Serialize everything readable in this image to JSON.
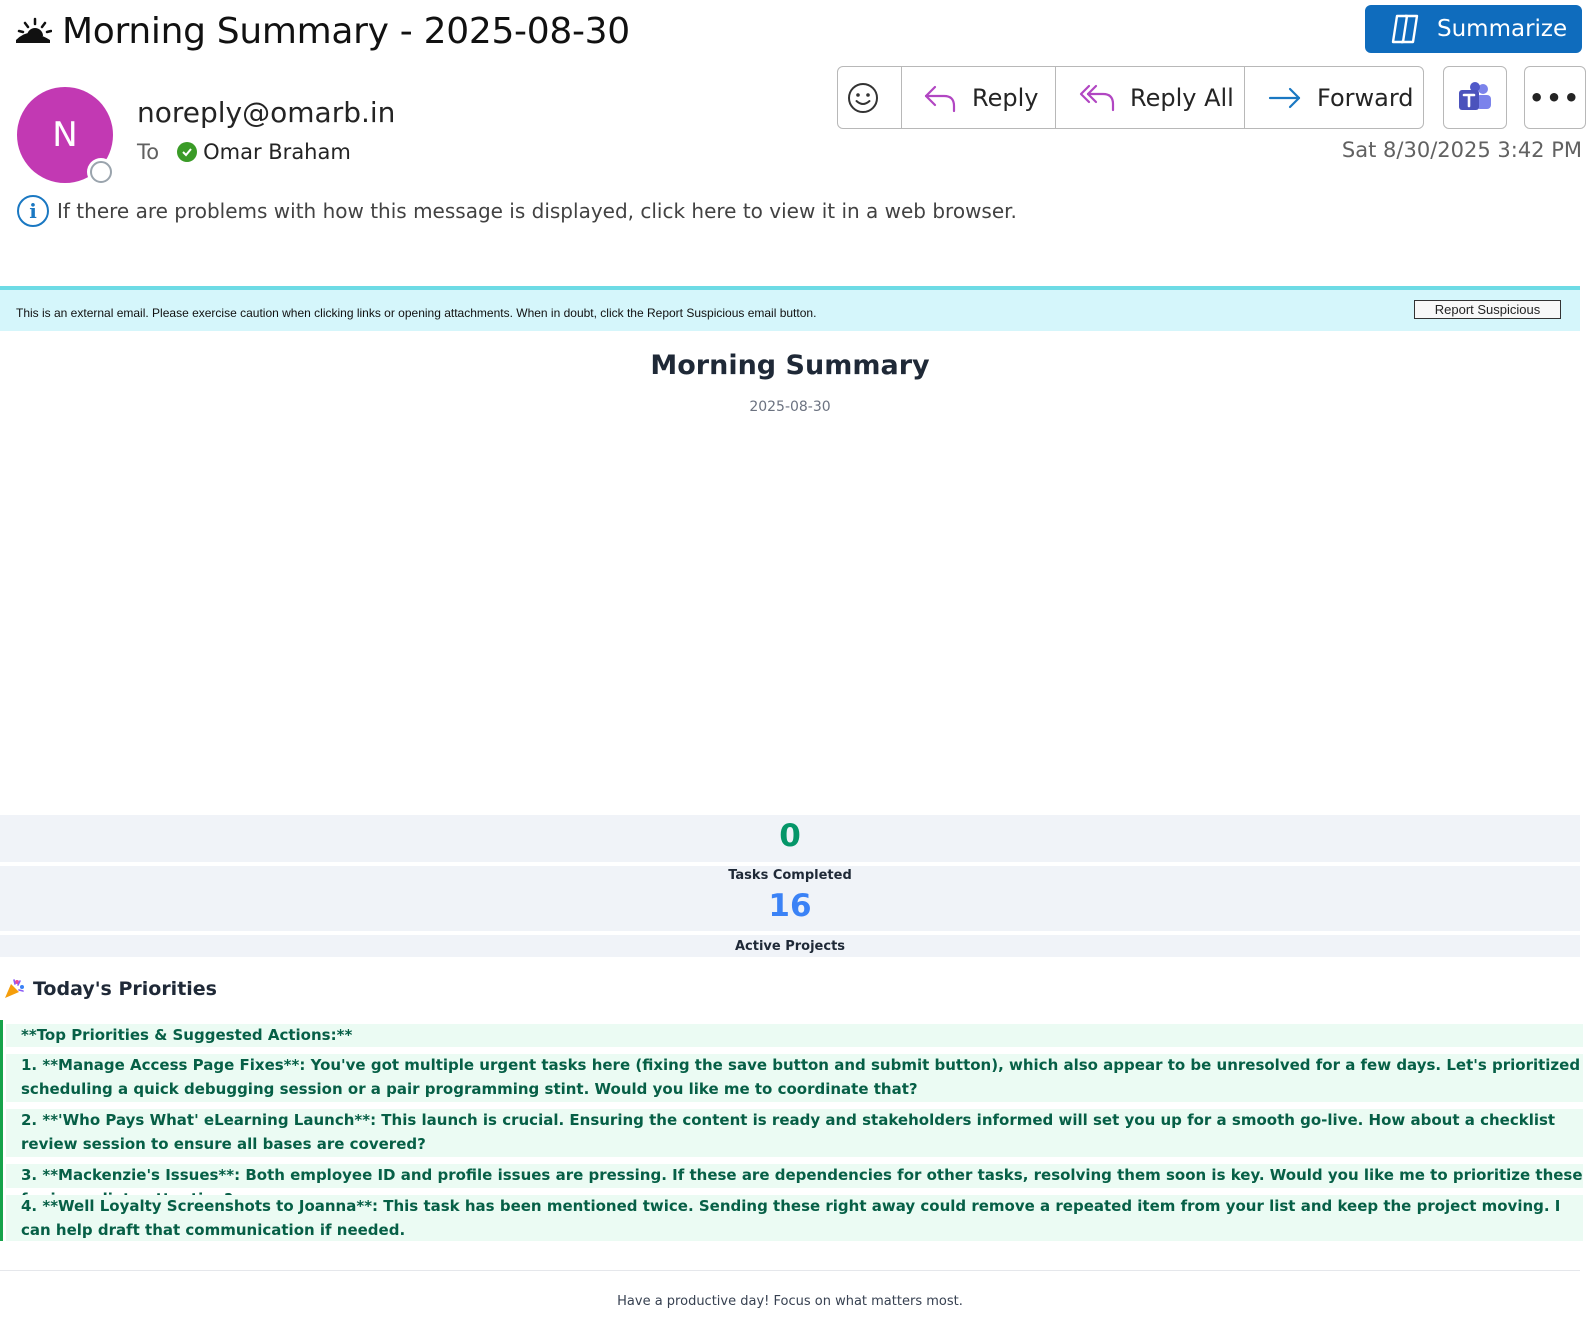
{
  "header": {
    "subject": "Morning Summary - 2025-08-30",
    "summarize_label": "Summarize",
    "sender_initial": "N",
    "sender": "noreply@omarb.in",
    "to_label": "To",
    "recipient": "Omar Braham",
    "date": "Sat 8/30/2025 3:42 PM",
    "actions": {
      "reply": "Reply",
      "reply_all": "Reply All",
      "forward": "Forward",
      "more": "•••"
    },
    "info_text": "If there are problems with how this message is displayed, click here to view it in a web browser."
  },
  "banner": {
    "text": "This is an external email. Please exercise caution when clicking links or opening attachments. When in doubt, click the Report Suspicious email button.",
    "report_label": "Report Suspicious"
  },
  "body": {
    "title": "Morning Summary",
    "date": "2025-08-30",
    "stats": [
      {
        "value": "0",
        "label": "Tasks Completed",
        "color": "#059669"
      },
      {
        "value": "16",
        "label": "Active Projects",
        "color": "#3b82f6"
      }
    ],
    "priorities_title": "Today's Priorities",
    "priorities": [
      "**Top Priorities & Suggested Actions:**",
      "1. **Manage Access Page Fixes**: You've got multiple urgent tasks here (fixing the save button and submit button), which also appear to be unresolved for a few days. Let's prioritized scheduling a quick debugging session or a pair programming stint. Would you like me to coordinate that?",
      "2. **'Who Pays What' eLearning Launch**: This launch is crucial. Ensuring the content is ready and stakeholders informed will set you up for a smooth go-live. How about a checklist review session to ensure all bases are covered?",
      "3. **Mackenzie's Issues**: Both employee ID and profile issues are pressing. If these are dependencies for other tasks, resolving them soon is key. Would you like me to prioritize these for immediate attention?",
      "4. **Well Loyalty Screenshots to Joanna**: This task has been mentioned twice. Sending these right away could remove a repeated item from your list and keep the project moving. I can help draft that communication if needed."
    ],
    "footer": "Have a productive day! Focus on what matters most."
  }
}
